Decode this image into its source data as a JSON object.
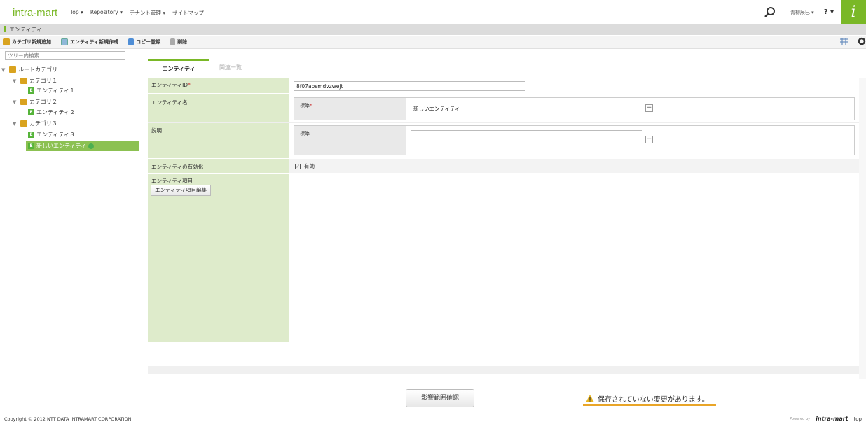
{
  "header": {
    "logo": "intra-mart",
    "nav": [
      {
        "label": "Top ▾"
      },
      {
        "label": "Repository ▾"
      },
      {
        "label": "テナント管理 ▾"
      },
      {
        "label": "サイトマップ"
      }
    ],
    "user": "青柳辰巳 ▾",
    "help": "? ▾",
    "brand_glyph": "i"
  },
  "subheader": {
    "title": "エンティティ"
  },
  "toolbar": {
    "add_category": "カテゴリ新規追加",
    "new_entity": "エンティティ新規作成",
    "copy_register": "コピー登録",
    "delete": "削除"
  },
  "tree": {
    "search_placeholder": "ツリー内検索",
    "root": "ルートカテゴリ",
    "categories": [
      {
        "label": "カテゴリ１",
        "entity": "エンティティ１"
      },
      {
        "label": "カテゴリ２",
        "entity": "エンティティ２"
      },
      {
        "label": "カテゴリ３",
        "entity": "エンティティ３"
      }
    ],
    "selected": "新しいエンティティ",
    "entity_badge": "E"
  },
  "tabs": [
    {
      "label": "エンティティ"
    },
    {
      "label": "関連一覧"
    }
  ],
  "form": {
    "entity_id_label": "エンティティID",
    "entity_id_value": "8f07absmdvzwejt",
    "entity_name_label": "エンティティ名",
    "standard_label": "標準",
    "entity_name_value": "新しいエンティティ",
    "description_label": "説明",
    "description_value": "",
    "enable_label": "エンティティの有効化",
    "enable_check_label": "有効",
    "items_label": "エンティティ項目",
    "items_edit_button": "エンティティ項目編集",
    "required_mark": "*",
    "plus": "+"
  },
  "footer": {
    "impact_button": "影響範囲確認",
    "warning": "保存されていない変更があります。",
    "copyright": "Copyright © 2012 NTT DATA INTRAMART CORPORATION",
    "powered": "Powered by",
    "powered_brand": "intra-mart",
    "top_link": "top"
  },
  "colors": {
    "accent": "#7ab827",
    "label_bg": "#deebcb",
    "selected_bg": "#8cc152",
    "warning": "#e9a528"
  },
  "icons": [
    "search-icon",
    "grid-icon",
    "gear-icon",
    "folder-icon",
    "entity-icon",
    "trash-icon",
    "warning-icon",
    "checkbox-icon"
  ]
}
